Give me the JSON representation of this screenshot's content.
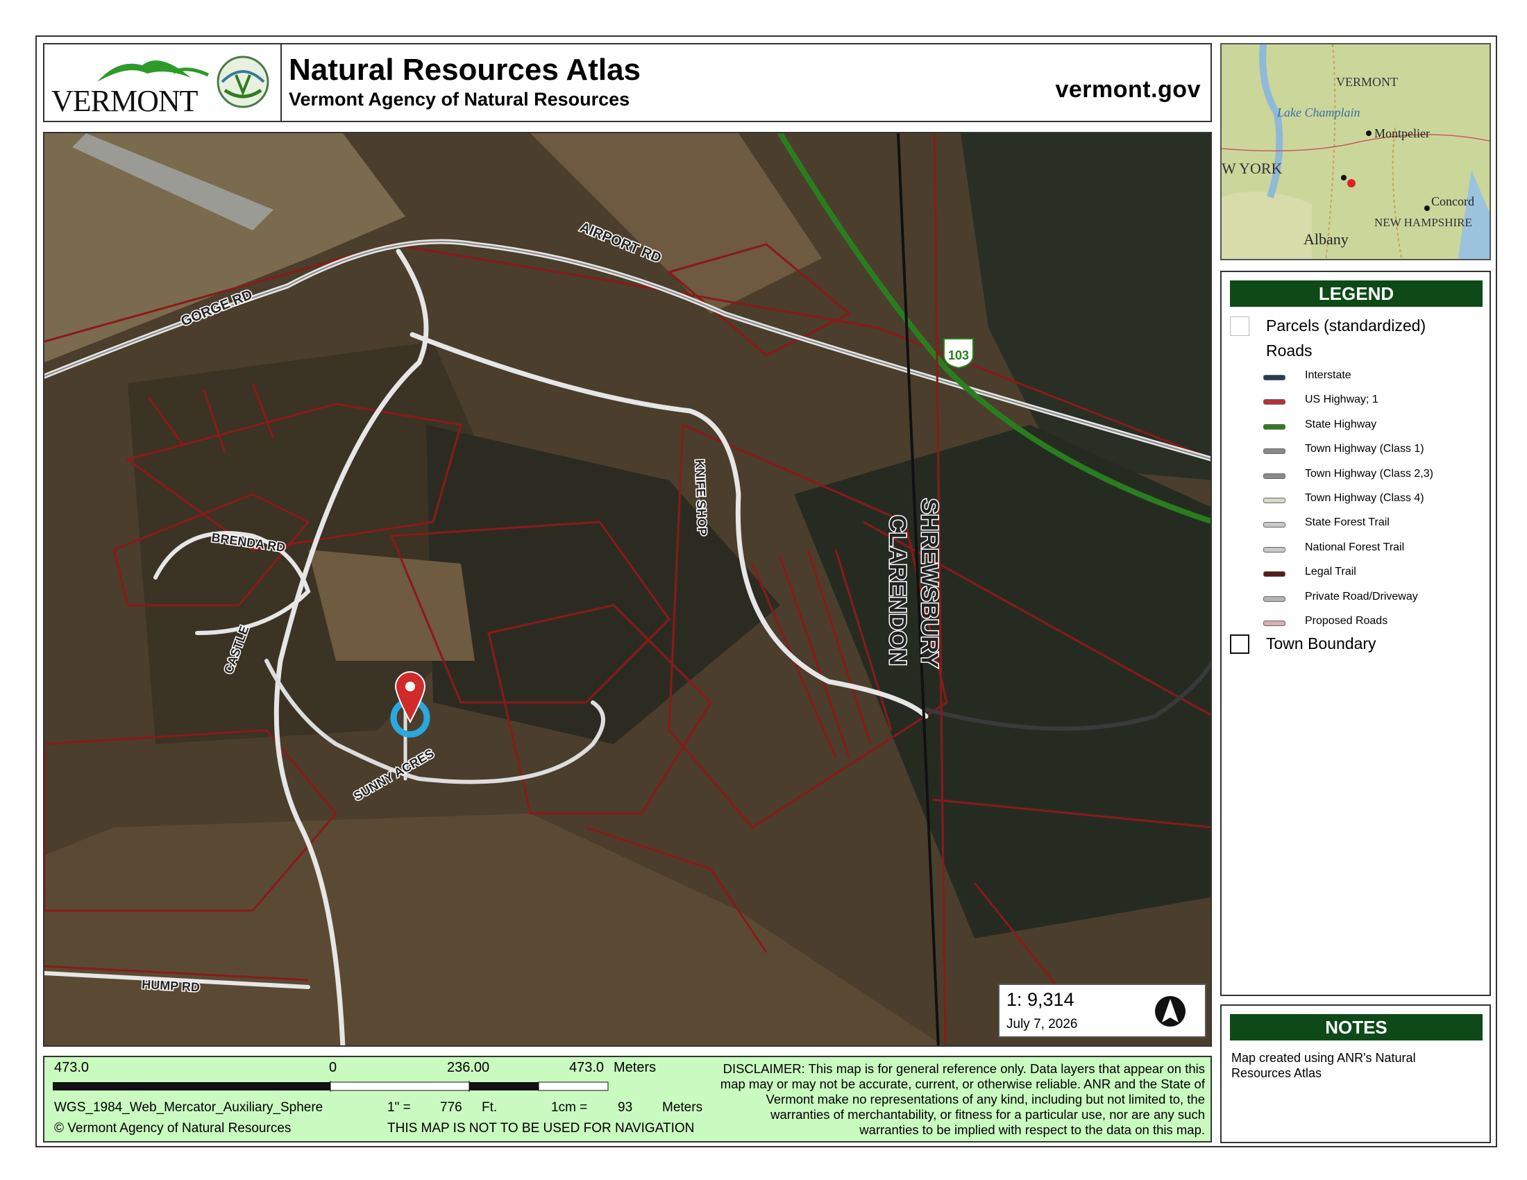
{
  "header": {
    "logo_text": "VERMONT",
    "title": "Natural Resources Atlas",
    "subtitle": "Vermont Agency of Natural Resources",
    "site": "vermont.gov"
  },
  "inset_map": {
    "labels": [
      "VERMONT",
      "Lake Champlain",
      "Montpelier",
      "W YORK",
      "Concord",
      "NEW HAMPSHIRE",
      "Albany"
    ]
  },
  "map": {
    "road_labels": [
      "AIRPORT RD",
      "GORGE RD",
      "BRENDA RD",
      "CASTLE",
      "SUNNY ACRES",
      "KNIFE SHOP",
      "HUMP RD"
    ],
    "town_labels": [
      "SHREWSBURY",
      "CLARENDON"
    ],
    "route_shield": "103",
    "scale_ratio": "1:  9,314",
    "date": "July 7, 2026",
    "north_icon": "north-arrow-icon"
  },
  "legend": {
    "heading": "LEGEND",
    "parcels": "Parcels (standardized)",
    "roads_heading": "Roads",
    "roads": [
      {
        "label": "Interstate",
        "color": "#2b3a55"
      },
      {
        "label": "US Highway; 1",
        "color": "#b83232"
      },
      {
        "label": "State Highway",
        "color": "#2e7d1e"
      },
      {
        "label": "Town Highway (Class 1)",
        "color": "#8a8a8a"
      },
      {
        "label": "Town Highway (Class 2,3)",
        "color": "#8a8a8a"
      },
      {
        "label": "Town Highway (Class 4)",
        "color": "#d8d8c8"
      },
      {
        "label": "State Forest Trail",
        "color": "#c8c8c8"
      },
      {
        "label": "National Forest Trail",
        "color": "#c8c8c8"
      },
      {
        "label": "Legal Trail",
        "color": "#5a1a1a"
      },
      {
        "label": "Private Road/Driveway",
        "color": "#b5b5b5"
      },
      {
        "label": "Proposed Roads",
        "color": "#d9b0b0"
      }
    ],
    "town_boundary": "Town Boundary"
  },
  "notes": {
    "heading": "NOTES",
    "text": "Map created using ANR's Natural Resources Atlas"
  },
  "footer": {
    "scale_left": "473.0",
    "scale_zero": "0",
    "scale_mid": "236.00",
    "scale_right": "473.0",
    "scale_units": "Meters",
    "projection": "WGS_1984_Web_Mercator_Auxiliary_Sphere",
    "inch_label": "1\" =",
    "inch_value": "776",
    "inch_units": "Ft.",
    "cm_label": "1cm =",
    "cm_value": "93",
    "cm_units": "Meters",
    "copyright": "© Vermont Agency of Natural Resources",
    "navigation": "THIS MAP IS NOT TO BE USED FOR NAVIGATION",
    "disclaimer": "DISCLAIMER: This map is for general reference only. Data layers that appear on this map may or may not be accurate, current, or otherwise reliable. ANR and the State of Vermont make no representations of any kind, including but not limited to, the warranties of merchantability, or fitness for a particular use, nor are any such warranties to be implied with respect to the data on this map."
  }
}
